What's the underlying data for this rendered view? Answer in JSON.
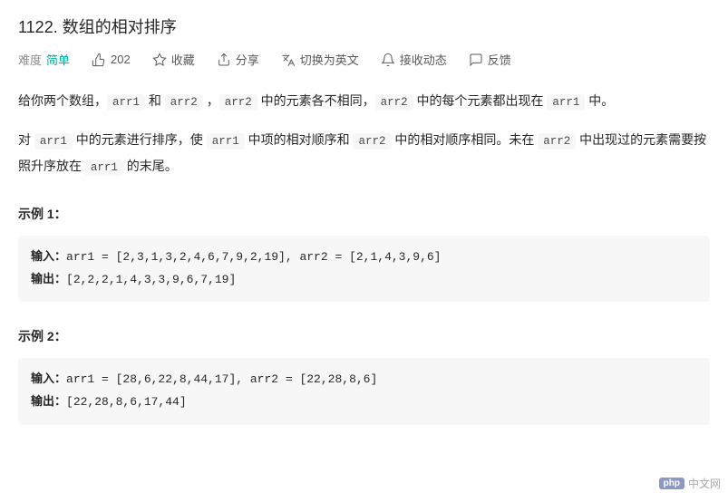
{
  "title": "1122. 数组的相对排序",
  "meta": {
    "difficulty_label": "难度",
    "difficulty_value": "简单",
    "likes": "202",
    "favorite": "收藏",
    "share": "分享",
    "switch_lang": "切换为英文",
    "notifications": "接收动态",
    "feedback": "反馈"
  },
  "description": {
    "p1_a": "给你两个数组，",
    "p1_b": " 和 ",
    "p1_c": " ，",
    "p1_d": " 中的元素各不相同，",
    "p1_e": " 中的每个元素都出现在 ",
    "p1_f": " 中。",
    "p2_a": "对 ",
    "p2_b": " 中的元素进行排序，使 ",
    "p2_c": " 中项的相对顺序和 ",
    "p2_d": " 中的相对顺序相同。未在 ",
    "p2_e": " 中出现过的元素需要按照升序放在 ",
    "p2_f": " 的末尾。",
    "code_arr1": "arr1",
    "code_arr2": "arr2"
  },
  "examples": {
    "ex1_title": "示例 1：",
    "ex2_title": "示例  2：",
    "input_label": "输入：",
    "output_label": "输出：",
    "ex1_input": "arr1 = [2,3,1,3,2,4,6,7,9,2,19], arr2 = [2,1,4,3,9,6]",
    "ex1_output": "[2,2,2,1,4,3,3,9,6,7,19]",
    "ex2_input": "arr1 = [28,6,22,8,44,17], arr2 = [22,28,8,6]",
    "ex2_output": "[22,28,8,6,17,44]"
  },
  "watermark": {
    "badge": "php",
    "text": "中文网"
  }
}
